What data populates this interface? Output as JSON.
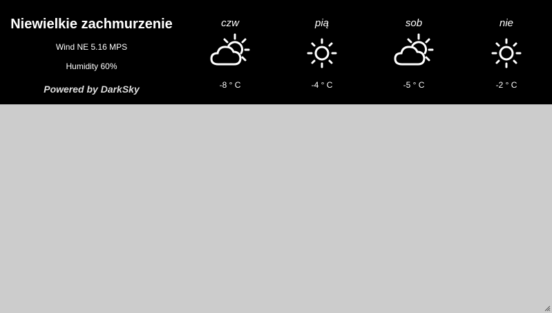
{
  "current": {
    "summary": "Niewielkie zachmurzenie",
    "wind": "Wind NE 5.16 MPS",
    "humidity": "Humidity 60%",
    "powered_by": "Powered by DarkSky"
  },
  "forecast": [
    {
      "day": "czw",
      "icon": "partly-cloudy-icon",
      "temp": "-8 ° C"
    },
    {
      "day": "pią",
      "icon": "sun-icon",
      "temp": "-4 ° C"
    },
    {
      "day": "sob",
      "icon": "partly-cloudy-icon",
      "temp": "-5 ° C"
    },
    {
      "day": "nie",
      "icon": "sun-icon",
      "temp": "-2 ° C"
    }
  ],
  "colors": {
    "panel_bg": "#000000",
    "text": "#ffffff",
    "page_bg": "#cccccc"
  }
}
